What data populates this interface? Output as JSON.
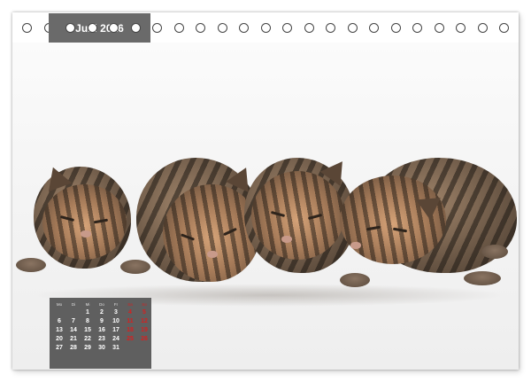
{
  "calendar": {
    "month_label": "Juni 2026",
    "weekday_headers": [
      "Mo",
      "Di",
      "Mi",
      "Do",
      "Fr",
      "Sa",
      "So"
    ],
    "weeks": [
      [
        "",
        "",
        "1",
        "2",
        "3",
        "4",
        "5"
      ],
      [
        "6",
        "7",
        "8",
        "9",
        "10",
        "11",
        "12"
      ],
      [
        "13",
        "14",
        "15",
        "16",
        "17",
        "18",
        "19"
      ],
      [
        "20",
        "21",
        "22",
        "23",
        "24",
        "25",
        "26"
      ],
      [
        "27",
        "28",
        "29",
        "30",
        "31",
        "",
        ""
      ]
    ]
  },
  "colors": {
    "label_background": "#6a6a6a",
    "calendar_background": "#5f5f5f",
    "weekend_red": "#d62020"
  },
  "photo": {
    "subject": "four sleeping tabby kittens"
  }
}
